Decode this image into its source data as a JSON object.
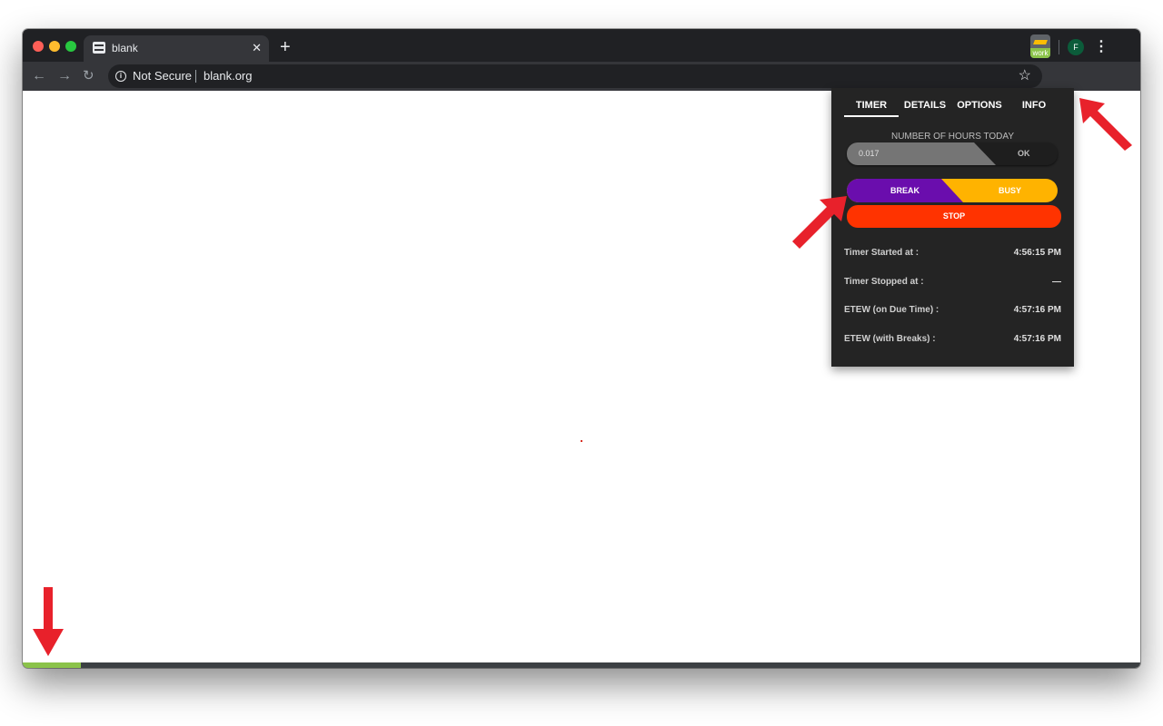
{
  "browser": {
    "tab_title": "blank",
    "tab_close": "✕",
    "new_tab": "+",
    "security_label": "Not Secure",
    "url": "blank.org",
    "back": "←",
    "forward": "→",
    "reload": "↻",
    "star": "☆",
    "extension_badge": "work",
    "avatar_initial": "F",
    "menu": "⋮",
    "progress_fraction": 0.052
  },
  "popup": {
    "tabs": [
      "TIMER",
      "DETAILS",
      "OPTIONS",
      "INFO"
    ],
    "active_tab": "TIMER",
    "hours_label": "NUMBER OF HOURS TODAY",
    "hours_value": "0.017",
    "ok_label": "OK",
    "break_label": "BREAK",
    "busy_label": "BUSY",
    "stop_label": "STOP",
    "rows": [
      {
        "label": "Timer Started at :",
        "value": "4:56:15 PM"
      },
      {
        "label": "Timer Stopped at :",
        "value": "—"
      },
      {
        "label": "ETEW (on Due Time) :",
        "value": "4:57:16 PM"
      },
      {
        "label": "ETEW (with Breaks) :",
        "value": "4:57:16 PM"
      }
    ]
  },
  "colors": {
    "break": "#6a0dad",
    "busy": "#ffb300",
    "stop": "#ff3300",
    "progress": "#8bc34a",
    "annotation_arrow": "#e8212b"
  }
}
